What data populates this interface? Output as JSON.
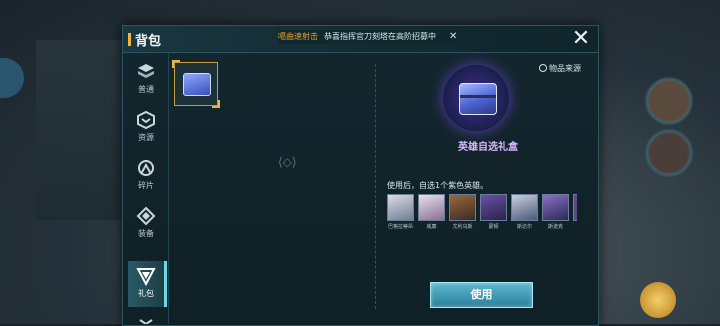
{
  "modal": {
    "title": "背包",
    "close_icon": "close-icon"
  },
  "ticker": {
    "highlight": "噶曲速射击",
    "message": "恭喜指挥官刀刻塔在高阶招募中",
    "close_icon": "close-icon"
  },
  "sidebar": {
    "items": [
      {
        "label": "普通",
        "icon": "cube-stack-icon",
        "active": false
      },
      {
        "label": "资源",
        "icon": "resource-icon",
        "active": false
      },
      {
        "label": "碎片",
        "icon": "fragment-icon",
        "active": false
      },
      {
        "label": "装备",
        "icon": "equipment-icon",
        "active": false
      },
      {
        "label": "礼包",
        "icon": "gift-icon",
        "active": true
      }
    ]
  },
  "detail": {
    "source_label": "物品来源",
    "item_name": "英雄自选礼盒",
    "description": "使用后，自选1个紫色英雄。",
    "heroes": [
      {
        "name": "巴格拉蒂昂"
      },
      {
        "name": "威廉"
      },
      {
        "name": "尤利乌斯"
      },
      {
        "name": "蒙顿"
      },
      {
        "name": "斯达尔"
      },
      {
        "name": "斯诺克"
      }
    ],
    "use_button": "使用"
  },
  "colors": {
    "accent_gold": "#f3b43c",
    "item_name_purple": "#d7b6ff",
    "use_button": "#3f9cb6",
    "ticker_orange": "#e49b2b"
  }
}
